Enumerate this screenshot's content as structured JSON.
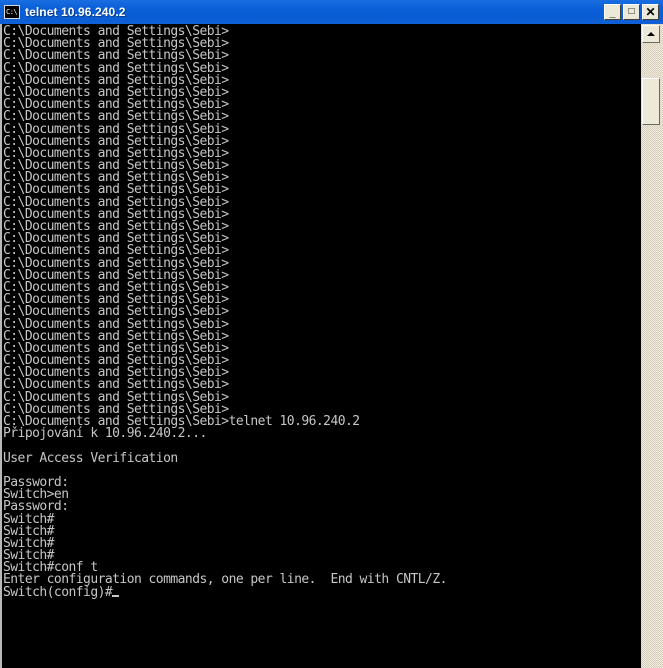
{
  "window": {
    "title": "telnet 10.96.240.2",
    "icon_name": "console-icon",
    "icon_glyph": "C:\\",
    "titlebar_color": "#0a5fd8",
    "title_text_color": "#ffffff"
  },
  "titlebar_buttons": {
    "minimize_label": "_",
    "maximize_label": "□",
    "close_label": "✕"
  },
  "terminal": {
    "background_color": "#000000",
    "text_color": "#c6c6c6",
    "prompt": "C:\\Documents and Settings\\Sebi>",
    "cursor_visible": true,
    "lines": [
      "C:\\Documents and Settings\\Sebi>",
      "C:\\Documents and Settings\\Sebi>",
      "C:\\Documents and Settings\\Sebi>",
      "C:\\Documents and Settings\\Sebi>",
      "C:\\Documents and Settings\\Sebi>",
      "C:\\Documents and Settings\\Sebi>",
      "C:\\Documents and Settings\\Sebi>",
      "C:\\Documents and Settings\\Sebi>",
      "C:\\Documents and Settings\\Sebi>",
      "C:\\Documents and Settings\\Sebi>",
      "C:\\Documents and Settings\\Sebi>",
      "C:\\Documents and Settings\\Sebi>",
      "C:\\Documents and Settings\\Sebi>",
      "C:\\Documents and Settings\\Sebi>",
      "C:\\Documents and Settings\\Sebi>",
      "C:\\Documents and Settings\\Sebi>",
      "C:\\Documents and Settings\\Sebi>",
      "C:\\Documents and Settings\\Sebi>",
      "C:\\Documents and Settings\\Sebi>",
      "C:\\Documents and Settings\\Sebi>",
      "C:\\Documents and Settings\\Sebi>",
      "C:\\Documents and Settings\\Sebi>",
      "C:\\Documents and Settings\\Sebi>",
      "C:\\Documents and Settings\\Sebi>",
      "C:\\Documents and Settings\\Sebi>",
      "C:\\Documents and Settings\\Sebi>",
      "C:\\Documents and Settings\\Sebi>",
      "C:\\Documents and Settings\\Sebi>",
      "C:\\Documents and Settings\\Sebi>",
      "C:\\Documents and Settings\\Sebi>",
      "C:\\Documents and Settings\\Sebi>",
      "C:\\Documents and Settings\\Sebi>",
      "C:\\Documents and Settings\\Sebi>telnet 10.96.240.2",
      "Připojování k 10.96.240.2...",
      "",
      "User Access Verification",
      "",
      "Password:",
      "Switch>en",
      "Password:",
      "Switch#",
      "Switch#",
      "Switch#",
      "Switch#",
      "Switch#conf t",
      "Enter configuration commands, one per line.  End with CNTL/Z.",
      "Switch(config)#"
    ]
  },
  "scrollbar": {
    "up_arrow_name": "scroll-up-arrow",
    "thumb_name": "scroll-thumb",
    "track_color": "#efeadd",
    "button_color": "#ece9d8"
  }
}
